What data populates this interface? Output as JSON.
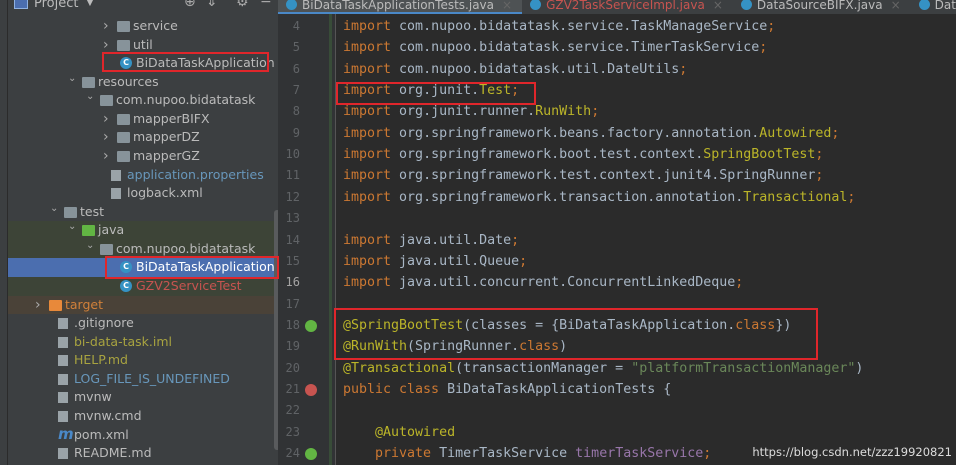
{
  "project_panel": {
    "title": "Project",
    "tools": [
      "locate-icon",
      "collapse-icon",
      "gear-icon",
      "minimize-icon"
    ],
    "tree": [
      {
        "label": "service",
        "type": "folder",
        "depth": 4,
        "expanded": false,
        "color": "#bbbbbb"
      },
      {
        "label": "util",
        "type": "folder",
        "depth": 4,
        "expanded": false,
        "color": "#bbbbbb"
      },
      {
        "label": "BiDataTaskApplication",
        "type": "class",
        "depth": 5,
        "color": "#bbbbbb",
        "highlighted": true
      },
      {
        "label": "resources",
        "type": "folder",
        "depth": 2,
        "expanded": true,
        "color": "#bbbbbb"
      },
      {
        "label": "com.nupoo.bidatatask",
        "type": "folder",
        "depth": 3,
        "expanded": true,
        "color": "#bbbbbb"
      },
      {
        "label": "mapperBIFX",
        "type": "folder",
        "depth": 4,
        "expanded": false,
        "color": "#bbbbbb"
      },
      {
        "label": "mapperDZ",
        "type": "folder",
        "depth": 4,
        "expanded": false,
        "color": "#bbbbbb"
      },
      {
        "label": "mapperGZ",
        "type": "folder",
        "depth": 4,
        "expanded": false,
        "color": "#bbbbbb"
      },
      {
        "label": "application.properties",
        "type": "file",
        "depth": 4,
        "color": "#6897bb"
      },
      {
        "label": "logback.xml",
        "type": "file",
        "depth": 4,
        "color": "#bbbbbb"
      },
      {
        "label": "test",
        "type": "folder",
        "depth": 1,
        "expanded": true,
        "color": "#bbbbbb"
      },
      {
        "label": "java",
        "type": "folder",
        "depth": 2,
        "expanded": true,
        "color": "#bbbbbb",
        "icon_color": "#62b543"
      },
      {
        "label": "com.nupoo.bidatatask",
        "type": "folder",
        "depth": 3,
        "expanded": true,
        "color": "#bbbbbb"
      },
      {
        "label": "BiDataTaskApplicationTests",
        "type": "class",
        "depth": 5,
        "color": "#ffffff",
        "selected": true,
        "highlighted": true
      },
      {
        "label": "GZV2ServiceTest",
        "type": "class",
        "depth": 5,
        "color": "#c75450"
      },
      {
        "label": "target",
        "type": "folder",
        "depth": 0,
        "expanded": false,
        "color": "#d0803a",
        "icon_color": "#e8893a"
      },
      {
        "label": ".gitignore",
        "type": "file",
        "depth": 1,
        "color": "#bbbbbb"
      },
      {
        "label": "bi-data-task.iml",
        "type": "file",
        "depth": 1,
        "color": "#a8a340"
      },
      {
        "label": "HELP.md",
        "type": "file",
        "depth": 1,
        "color": "#a8a340"
      },
      {
        "label": "LOG_FILE_IS_UNDEFINED",
        "type": "file",
        "depth": 1,
        "color": "#6897bb"
      },
      {
        "label": "mvnw",
        "type": "file",
        "depth": 1,
        "color": "#bbbbbb"
      },
      {
        "label": "mvnw.cmd",
        "type": "file",
        "depth": 1,
        "color": "#bbbbbb"
      },
      {
        "label": "pom.xml",
        "type": "maven",
        "depth": 1,
        "color": "#bbbbbb"
      },
      {
        "label": "README.md",
        "type": "file",
        "depth": 1,
        "color": "#bbbbbb"
      }
    ]
  },
  "tabs": [
    {
      "label": "BiDataTaskApplicationTests.java",
      "active": true,
      "color": "#bbbbbb"
    },
    {
      "label": "GZV2TaskServiceImpl.java",
      "active": false,
      "color": "#c75450"
    },
    {
      "label": "DataSourceBIFX.java",
      "active": false,
      "color": "#bbbbbb"
    },
    {
      "label": "DataSourceConfi",
      "active": false,
      "color": "#bbbbbb"
    }
  ],
  "editor": {
    "current_line": 16,
    "lines": [
      {
        "n": 4,
        "t": [
          [
            "import ",
            "k"
          ],
          [
            "com.nupoo.bidatatask.service.TaskManageService",
            "p"
          ],
          [
            ";",
            "k"
          ]
        ]
      },
      {
        "n": 5,
        "t": [
          [
            "import ",
            "k"
          ],
          [
            "com.nupoo.bidatatask.service.TimerTaskService",
            "p"
          ],
          [
            ";",
            "k"
          ]
        ]
      },
      {
        "n": 6,
        "t": [
          [
            "import ",
            "k"
          ],
          [
            "com.nupoo.bidatatask.util.DateUtils",
            "p"
          ],
          [
            ";",
            "k"
          ]
        ]
      },
      {
        "n": 7,
        "t": [
          [
            "import ",
            "k"
          ],
          [
            "org.junit.",
            "p"
          ],
          [
            "Test",
            "a"
          ],
          [
            ";",
            "k"
          ]
        ]
      },
      {
        "n": 8,
        "t": [
          [
            "import ",
            "k"
          ],
          [
            "org.junit.runner.",
            "p"
          ],
          [
            "RunWith",
            "a"
          ],
          [
            ";",
            "k"
          ]
        ]
      },
      {
        "n": 9,
        "t": [
          [
            "import ",
            "k"
          ],
          [
            "org.springframework.beans.factory.annotation.",
            "p"
          ],
          [
            "Autowired",
            "a"
          ],
          [
            ";",
            "k"
          ]
        ]
      },
      {
        "n": 10,
        "t": [
          [
            "import ",
            "k"
          ],
          [
            "org.springframework.boot.test.context.",
            "p"
          ],
          [
            "SpringBootTest",
            "a"
          ],
          [
            ";",
            "k"
          ]
        ]
      },
      {
        "n": 11,
        "t": [
          [
            "import ",
            "k"
          ],
          [
            "org.springframework.test.context.junit4.SpringRunner",
            "p"
          ],
          [
            ";",
            "k"
          ]
        ]
      },
      {
        "n": 12,
        "t": [
          [
            "import ",
            "k"
          ],
          [
            "org.springframework.transaction.annotation.",
            "p"
          ],
          [
            "Transactional",
            "a"
          ],
          [
            ";",
            "k"
          ]
        ]
      },
      {
        "n": 13,
        "t": []
      },
      {
        "n": 14,
        "t": [
          [
            "import ",
            "k"
          ],
          [
            "java.util.Date",
            "p"
          ],
          [
            ";",
            "k"
          ]
        ]
      },
      {
        "n": 15,
        "t": [
          [
            "import ",
            "k"
          ],
          [
            "java.util.Queue",
            "p"
          ],
          [
            ";",
            "k"
          ]
        ]
      },
      {
        "n": 16,
        "t": [
          [
            "import ",
            "k"
          ],
          [
            "java.util.concurrent.ConcurrentLinkedDeque",
            "p"
          ],
          [
            ";",
            "k"
          ]
        ]
      },
      {
        "n": 17,
        "t": []
      },
      {
        "n": 18,
        "t": [
          [
            "@SpringBootTest",
            "a"
          ],
          [
            "(classes = {BiDataTaskApplication.",
            "p"
          ],
          [
            "class",
            "k"
          ],
          [
            "})",
            "p"
          ]
        ]
      },
      {
        "n": 19,
        "t": [
          [
            "@RunWith",
            "a"
          ],
          [
            "(SpringRunner.",
            "p"
          ],
          [
            "class",
            "k"
          ],
          [
            ")",
            "p"
          ]
        ]
      },
      {
        "n": 20,
        "t": [
          [
            "@Transactional",
            "a"
          ],
          [
            "(transactionManager = ",
            "p"
          ],
          [
            "\"platformTransactionManager\"",
            "s"
          ],
          [
            ")",
            "p"
          ]
        ]
      },
      {
        "n": 21,
        "t": [
          [
            "public class ",
            "k"
          ],
          [
            "BiDataTaskApplicationTests {",
            "p"
          ]
        ]
      },
      {
        "n": 22,
        "t": []
      },
      {
        "n": 23,
        "t": [
          [
            "    @Autowired",
            "a"
          ]
        ]
      },
      {
        "n": 24,
        "t": [
          [
            "    private ",
            "k"
          ],
          [
            "TimerTaskService ",
            "p"
          ],
          [
            "timerTaskService",
            "f"
          ],
          [
            ";",
            "k"
          ]
        ]
      }
    ]
  },
  "watermark": "https://blog.csdn.net/zzz19920821"
}
